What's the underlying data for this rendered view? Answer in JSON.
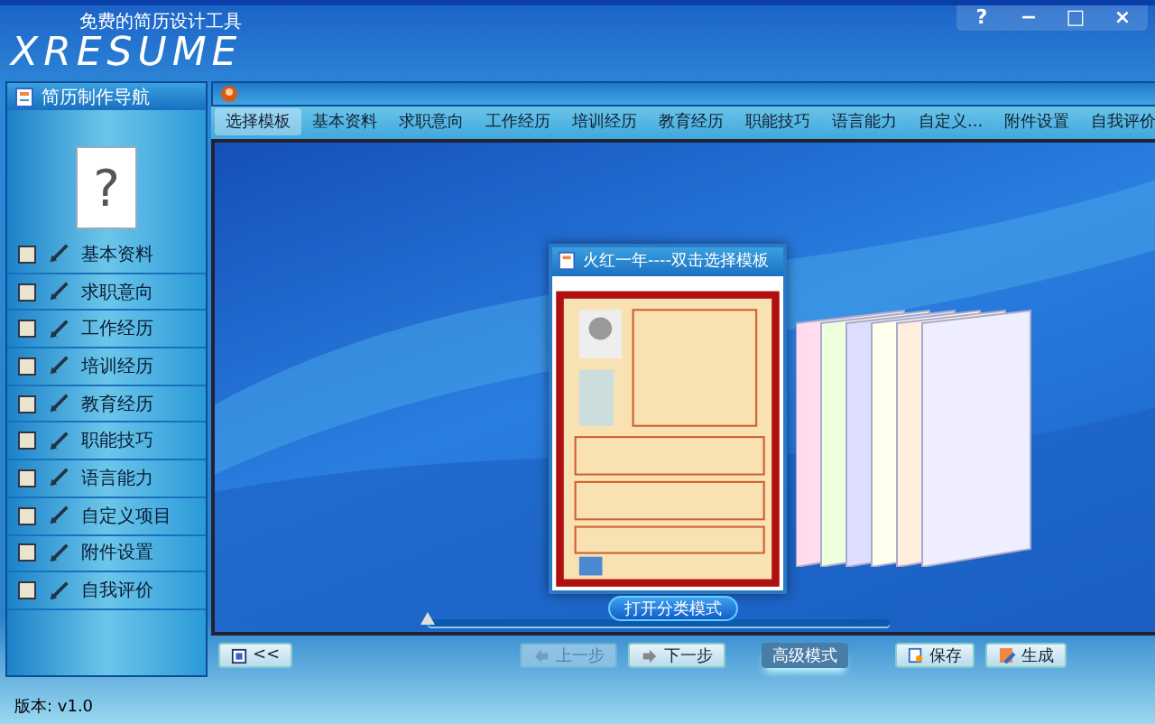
{
  "header": {
    "logo": "XRESUME",
    "tagline": "免费的简历设计工具",
    "window_buttons": [
      "?",
      "−",
      "□",
      "×"
    ]
  },
  "nav_panel": {
    "title": "简历制作导航",
    "photo_placeholder": "?",
    "items": [
      {
        "label": "基本资料",
        "checked": false
      },
      {
        "label": "求职意向",
        "checked": false
      },
      {
        "label": "工作经历",
        "checked": false
      },
      {
        "label": "培训经历",
        "checked": false
      },
      {
        "label": "教育经历",
        "checked": false
      },
      {
        "label": "职能技巧",
        "checked": false
      },
      {
        "label": "语言能力",
        "checked": false
      },
      {
        "label": "自定义项目",
        "checked": false
      },
      {
        "label": "附件设置",
        "checked": false
      },
      {
        "label": "自我评价",
        "checked": false
      }
    ]
  },
  "main_panel": {
    "tabs": [
      {
        "label": "选择模板",
        "selected": true
      },
      {
        "label": "基本资料",
        "selected": false
      },
      {
        "label": "求职意向",
        "selected": false
      },
      {
        "label": "工作经历",
        "selected": false
      },
      {
        "label": "培训经历",
        "selected": false
      },
      {
        "label": "教育经历",
        "selected": false
      },
      {
        "label": "职能技巧",
        "selected": false
      },
      {
        "label": "语言能力",
        "selected": false
      },
      {
        "label": "自定义...",
        "selected": false
      },
      {
        "label": "附件设置",
        "selected": false
      },
      {
        "label": "自我评价",
        "selected": false
      }
    ],
    "template_card": {
      "title": "火红一年----双击选择模板"
    },
    "slider": {
      "level": 0.0
    },
    "category_button": "打开分类模式"
  },
  "bottom_bar": {
    "buttons": [
      {
        "kind": "collapse",
        "label": "<<",
        "disabled": false,
        "selected": false
      },
      {
        "kind": "prev",
        "label": "上一步",
        "disabled": true,
        "selected": false
      },
      {
        "kind": "next",
        "label": "下一步",
        "disabled": false,
        "selected": false
      },
      {
        "kind": "mode",
        "label": "高级模式",
        "disabled": false,
        "selected": true
      },
      {
        "kind": "save",
        "label": "保存",
        "disabled": false,
        "selected": false
      },
      {
        "kind": "build",
        "label": "生成",
        "disabled": false,
        "selected": false
      }
    ]
  },
  "version": "版本: v1.0"
}
